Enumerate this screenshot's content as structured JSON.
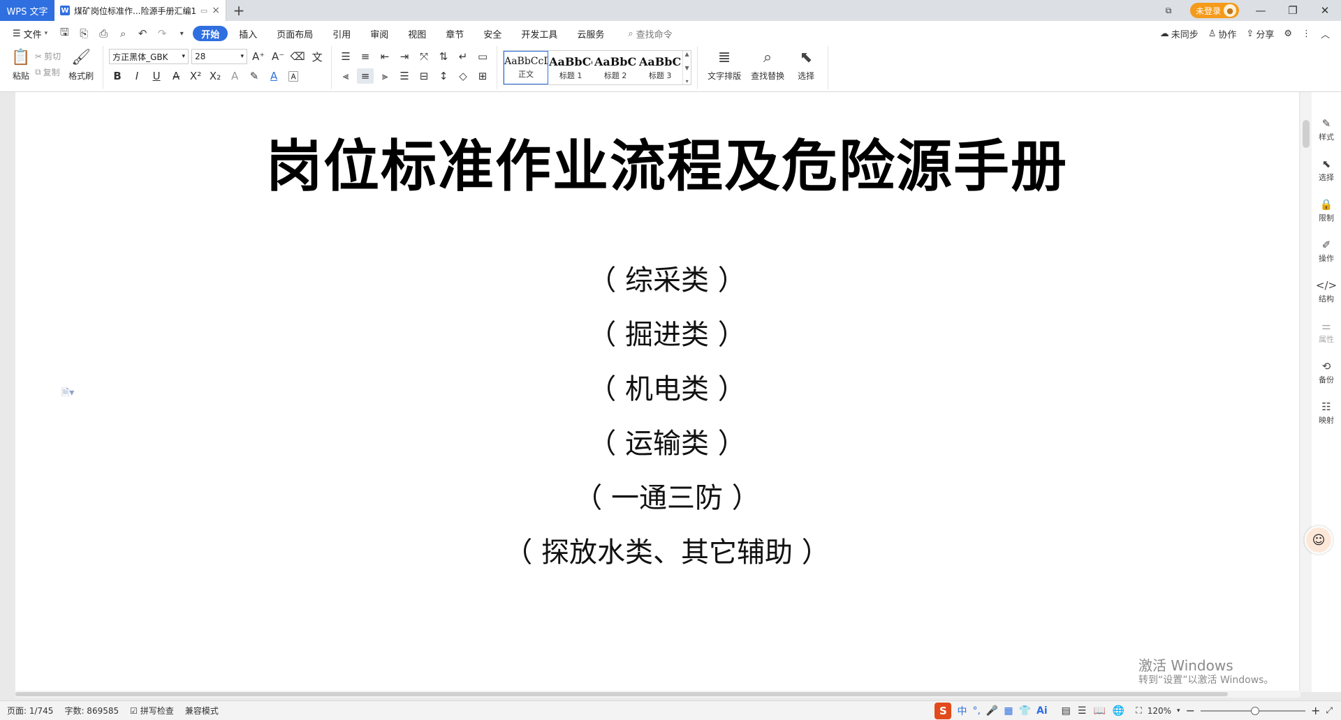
{
  "titlebar": {
    "app_tab": "WPS 文字",
    "doc_tab": "煤矿岗位标准作...险源手册汇编1",
    "login": "未登录"
  },
  "menubar": {
    "file": "文件",
    "tabs": [
      "开始",
      "插入",
      "页面布局",
      "引用",
      "审阅",
      "视图",
      "章节",
      "安全",
      "开发工具",
      "云服务"
    ],
    "active_tab": "开始",
    "search_cmd": "查找命令",
    "right": {
      "sync": "未同步",
      "collab": "协作",
      "share": "分享"
    }
  },
  "ribbon": {
    "paste": "粘贴",
    "cut": "剪切",
    "copy": "复制",
    "format_painter": "格式刷",
    "font_name": "方正黑体_GBK",
    "font_size": "28",
    "styles": [
      {
        "sample": "AaBbCcDd",
        "label": "正文"
      },
      {
        "sample": "AaBbCc",
        "label": "标题 1"
      },
      {
        "sample": "AaBbC",
        "label": "标题 2"
      },
      {
        "sample": "AaBbC",
        "label": "标题 3"
      }
    ],
    "text_layout": "文字排版",
    "find_replace": "查找替换",
    "select": "选择"
  },
  "document": {
    "title": "岗位标准作业流程及危险源手册",
    "lines": [
      "（ 综采类 ）",
      "（ 掘进类 ）",
      "（ 机电类 ）",
      "（ 运输类 ）",
      "（ 一通三防 ）",
      "（ 探放水类、其它辅助 ）"
    ]
  },
  "watermark": {
    "line1": "激活 Windows",
    "line2": "转到“设置”以激活 Windows。"
  },
  "rightpanel": [
    "样式",
    "选择",
    "限制",
    "操作",
    "结构",
    "属性",
    "备份",
    "映射"
  ],
  "statusbar": {
    "page": "页面: 1/745",
    "word_count": "字数: 869585",
    "spell_check": "拼写检查",
    "compat_mode": "兼容模式",
    "ime_lang": "中",
    "zoom": "120%"
  },
  "colors": {
    "accent": "#2f6fe0",
    "login": "#f59a1a"
  }
}
